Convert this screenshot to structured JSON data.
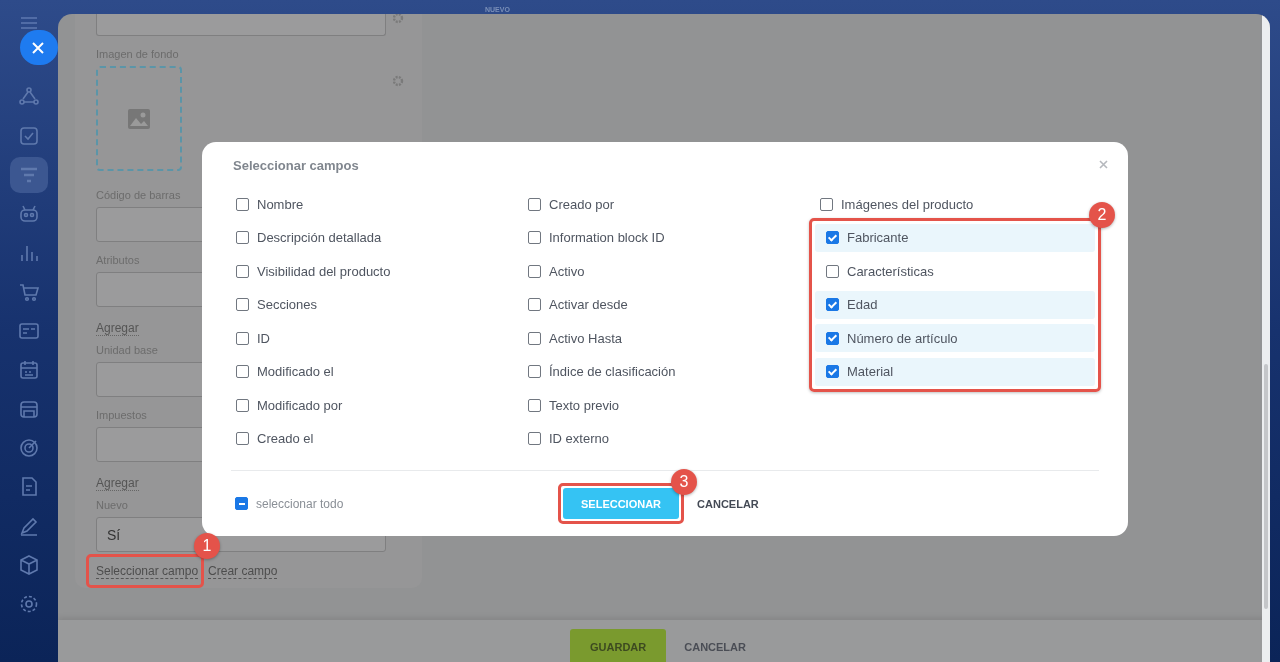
{
  "top_label": "NUEVO",
  "form": {
    "fields": [
      {
        "kind": "input"
      },
      {
        "kind": "image",
        "label": "Imagen de fondo"
      },
      {
        "kind": "input",
        "label": "Código de barras"
      },
      {
        "kind": "input",
        "label": "Atributos"
      },
      {
        "kind": "link",
        "label": "Agregar"
      },
      {
        "kind": "input",
        "label": "Unidad base"
      },
      {
        "kind": "input",
        "label": "Impuestos"
      },
      {
        "kind": "link",
        "label": "Agregar"
      },
      {
        "kind": "input",
        "label": "Nuevo",
        "value": "Sí"
      }
    ],
    "links": [
      {
        "label": "Seleccionar campo",
        "callout": "1"
      },
      {
        "label": "Crear campo"
      }
    ]
  },
  "footer": {
    "buttons": [
      {
        "label": "GUARDAR",
        "kind": "primary"
      },
      {
        "label": "CANCELAR",
        "kind": "link"
      }
    ]
  },
  "dialog": {
    "title": "Seleccionar campos",
    "columns": [
      {
        "items": [
          {
            "label": "Nombre",
            "checked": false
          },
          {
            "label": "Descripción detallada",
            "checked": false
          },
          {
            "label": "Visibilidad del producto",
            "checked": false
          },
          {
            "label": "Secciones",
            "checked": false
          },
          {
            "label": "ID",
            "checked": false
          },
          {
            "label": "Modificado el",
            "checked": false
          },
          {
            "label": "Modificado por",
            "checked": false
          },
          {
            "label": "Creado el",
            "checked": false
          }
        ]
      },
      {
        "items": [
          {
            "label": "Creado por",
            "checked": false
          },
          {
            "label": "Information block ID",
            "checked": false
          },
          {
            "label": "Activo",
            "checked": false
          },
          {
            "label": "Activar desde",
            "checked": false
          },
          {
            "label": "Activo Hasta",
            "checked": false
          },
          {
            "label": "Índice de clasificación",
            "checked": false
          },
          {
            "label": "Texto previo",
            "checked": false
          },
          {
            "label": "ID externo",
            "checked": false
          }
        ]
      },
      {
        "items": [
          {
            "label": "Imágenes del producto",
            "checked": false
          }
        ],
        "highlighted": {
          "callout": "2",
          "items": [
            {
              "label": "Fabricante",
              "checked": true
            },
            {
              "label": "Características",
              "checked": false
            },
            {
              "label": "Edad",
              "checked": true
            },
            {
              "label": "Número de artículo",
              "checked": true
            },
            {
              "label": "Material",
              "checked": true
            }
          ]
        }
      }
    ],
    "select_all": {
      "label": "seleccionar todo",
      "indeterminate": true
    },
    "buttons": [
      {
        "label": "SELECCIONAR",
        "kind": "primary",
        "callout": "3"
      },
      {
        "label": "CANCELAR",
        "kind": "link"
      }
    ]
  }
}
